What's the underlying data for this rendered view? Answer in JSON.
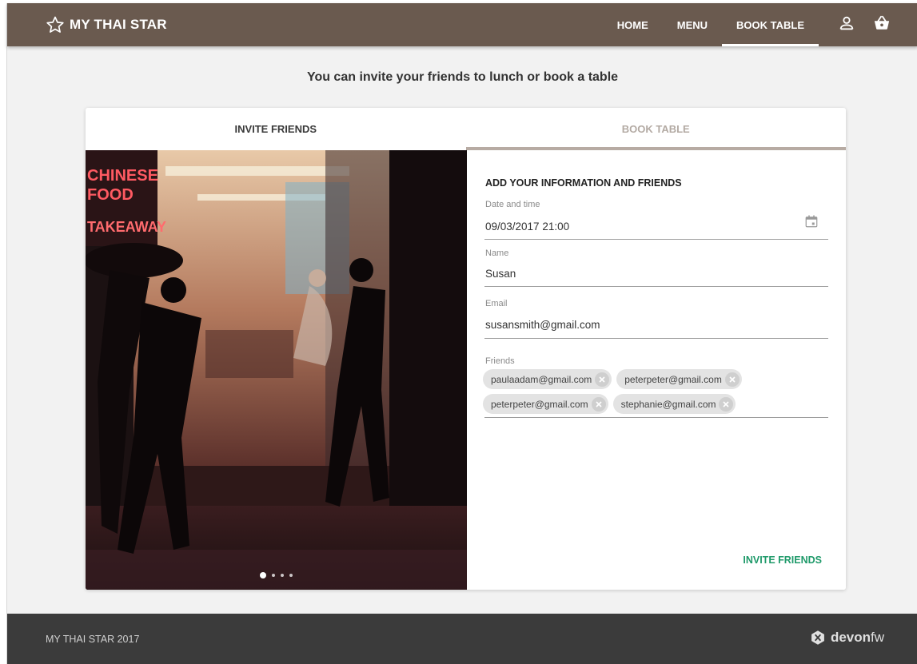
{
  "header": {
    "brand": "MY THAI STAR",
    "nav": [
      {
        "label": "HOME",
        "active": false
      },
      {
        "label": "MENU",
        "active": false
      },
      {
        "label": "BOOK TABLE",
        "active": true
      }
    ],
    "icons": [
      "user-icon",
      "cart-icon"
    ]
  },
  "subtitle": "You can invite your friends to lunch or book a table",
  "tabs": {
    "invite": "INVITE FRIENDS",
    "book": "BOOK TABLE"
  },
  "photo": {
    "signs": [
      "CHINESE",
      "FOOD",
      "TAKEAWAY"
    ],
    "carousel": {
      "count": 4,
      "active": 0
    }
  },
  "form": {
    "title": "ADD YOUR INFORMATION AND FRIENDS",
    "date": {
      "label": "Date and time",
      "value": "09/03/2017  21:00"
    },
    "name": {
      "label": "Name",
      "value": "Susan"
    },
    "email": {
      "label": "Email",
      "value": "susansmith@gmail.com"
    },
    "friends": {
      "label": "Friends",
      "chips": [
        "paulaadam@gmail.com",
        "peterpeter@gmail.com",
        "peterpeter@gmail.com",
        "stephanie@gmail.com"
      ]
    },
    "submit": "INVITE FRIENDS"
  },
  "footer": {
    "copyright": "MY THAI STAR 2017",
    "logo_part1": "devon",
    "logo_part2": "fw"
  },
  "colors": {
    "header": "#6a5a4f",
    "accent": "#1f9a6a",
    "footer": "#3b3b3b"
  }
}
